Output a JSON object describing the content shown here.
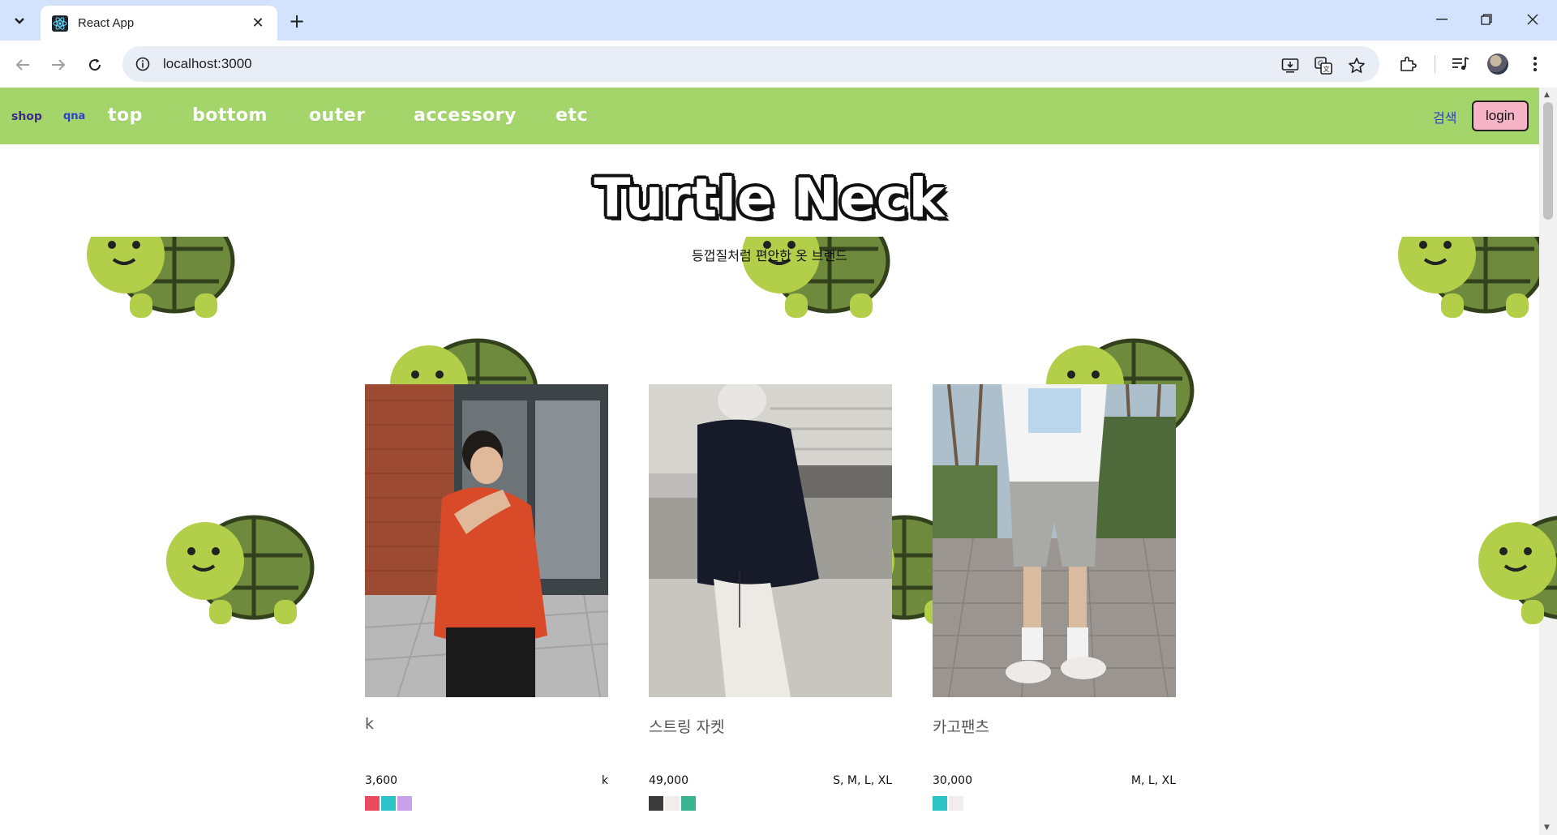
{
  "browser": {
    "tab_title": "React App",
    "url": "localhost:3000"
  },
  "nav": {
    "shop": "shop",
    "qna": "qna",
    "categories": [
      "top",
      "bottom",
      "outer",
      "accessory",
      "etc"
    ],
    "search": "검색",
    "login": "login"
  },
  "hero": {
    "brand": "Turtle Neck",
    "subtitle": "등껍질처럼 편안한 옷 브랜드"
  },
  "products": [
    {
      "name": "k",
      "price": "3,600",
      "sizes": "k",
      "colors": [
        "#e84a5f",
        "#2ec4c7",
        "#c9a0ea"
      ]
    },
    {
      "name": "스트링 자켓",
      "price": "49,000",
      "sizes": "S, M, L, XL",
      "colors": [
        "#3a3a3a",
        "#f2ecec",
        "#3bb38f"
      ]
    },
    {
      "name": "카고팬츠",
      "price": "30,000",
      "sizes": "M, L, XL",
      "colors": [
        "#2ec4c7",
        "#f2ecec"
      ]
    }
  ],
  "theme": {
    "nav_bg": "#a3d56a",
    "login_bg": "#f7b4c6",
    "turtle_shell": "#6e8b3d",
    "turtle_body": "#b3cf4a"
  }
}
